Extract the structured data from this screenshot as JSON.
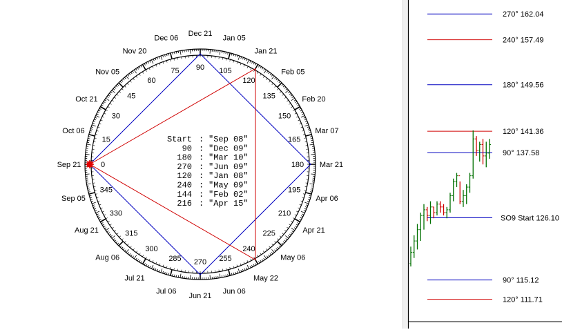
{
  "wheel": {
    "center_marker_color": "#e00000",
    "date_labels": [
      {
        "text": "Jun 21",
        "angle": 270
      },
      {
        "text": "Jun 06",
        "angle": 255
      },
      {
        "text": "Jul 06",
        "angle": 285
      },
      {
        "text": "May 22",
        "angle": 240
      },
      {
        "text": "Jul 21",
        "angle": 300
      },
      {
        "text": "May 06",
        "angle": 225
      },
      {
        "text": "Aug 06",
        "angle": 315
      },
      {
        "text": "Apr 21",
        "angle": 210
      },
      {
        "text": "Aug 21",
        "angle": 330
      },
      {
        "text": "Apr 06",
        "angle": 195
      },
      {
        "text": "Sep 05",
        "angle": 345
      },
      {
        "text": "Mar 21",
        "angle": 180
      },
      {
        "text": "Sep 21",
        "angle": 0
      },
      {
        "text": "Mar 07",
        "angle": 165
      },
      {
        "text": "Oct 06",
        "angle": 15
      },
      {
        "text": "Feb 20",
        "angle": 150
      },
      {
        "text": "Oct 21",
        "angle": 30
      },
      {
        "text": "Feb 05",
        "angle": 135
      },
      {
        "text": "Nov 05",
        "angle": 45
      },
      {
        "text": "Jan 21",
        "angle": 120
      },
      {
        "text": "Nov 20",
        "angle": 60
      },
      {
        "text": "Jan 05",
        "angle": 105
      },
      {
        "text": "Dec 06",
        "angle": 75
      },
      {
        "text": "Dec 21",
        "angle": 90
      }
    ],
    "degree_labels": [
      "0",
      "15",
      "30",
      "45",
      "60",
      "75",
      "90",
      "105",
      "120",
      "135",
      "150",
      "165",
      "180",
      "195",
      "210",
      "225",
      "240",
      "255",
      "270",
      "285",
      "300",
      "315",
      "330",
      "345"
    ],
    "legend": [
      {
        "label": "Start",
        "value": "\"Sep 08\""
      },
      {
        "label": "90",
        "value": "\"Dec 09\""
      },
      {
        "label": "180",
        "value": "\"Mar 10\""
      },
      {
        "label": "270",
        "value": "\"Jun 09\""
      },
      {
        "label": "120",
        "value": "\"Jan 08\""
      },
      {
        "label": "240",
        "value": "\"May 09\""
      },
      {
        "label": "144",
        "value": "\"Feb 02\""
      },
      {
        "label": "216",
        "value": "\"Apr 15\""
      }
    ],
    "square_color": "#0000c0",
    "triangle_color": "#d00000",
    "square_angles": [
      0,
      90,
      180,
      270
    ],
    "triangle_angles": [
      0,
      120,
      240
    ]
  },
  "chart_data": {
    "type": "line",
    "title": "",
    "levels": [
      {
        "label": "270° 162.04",
        "value": 162.04,
        "color": "#0000c0"
      },
      {
        "label": "240° 157.49",
        "value": 157.49,
        "color": "#d00000"
      },
      {
        "label": "180° 149.56",
        "value": 149.56,
        "color": "#0000c0"
      },
      {
        "label": "120° 141.36",
        "value": 141.36,
        "color": "#d00000"
      },
      {
        "label": "90° 137.58",
        "value": 137.58,
        "color": "#0000c0"
      },
      {
        "label": "SO9 Start 126.10",
        "value": 126.1,
        "color": "#0000c0"
      },
      {
        "label": "90° 115.12",
        "value": 115.12,
        "color": "#0000c0"
      },
      {
        "label": "120° 111.71",
        "value": 111.71,
        "color": "#d00000"
      }
    ],
    "price_range": [
      108.5,
      164.5
    ],
    "bars": [
      {
        "h": 121.0,
        "l": 117.5,
        "o": 118.0,
        "c": 120.0
      },
      {
        "h": 123.0,
        "l": 119.0,
        "o": 120.0,
        "c": 122.0
      },
      {
        "h": 125.0,
        "l": 120.5,
        "o": 122.0,
        "c": 124.0
      },
      {
        "h": 127.0,
        "l": 122.0,
        "o": 124.0,
        "c": 126.5
      },
      {
        "h": 128.5,
        "l": 124.0,
        "o": 126.5,
        "c": 127.5
      },
      {
        "h": 128.0,
        "l": 125.5,
        "o": 127.5,
        "c": 126.5
      },
      {
        "h": 129.0,
        "l": 125.0,
        "o": 126.5,
        "c": 128.0
      },
      {
        "h": 128.0,
        "l": 126.0,
        "o": 128.0,
        "c": 127.0
      },
      {
        "h": 129.0,
        "l": 126.5,
        "o": 127.0,
        "c": 128.5
      },
      {
        "h": 129.0,
        "l": 127.0,
        "o": 128.5,
        "c": 128.0
      },
      {
        "h": 128.5,
        "l": 126.5,
        "o": 128.0,
        "c": 127.0
      },
      {
        "h": 128.0,
        "l": 126.0,
        "o": 127.0,
        "c": 127.5
      },
      {
        "h": 130.5,
        "l": 127.0,
        "o": 127.5,
        "c": 130.0
      },
      {
        "h": 133.0,
        "l": 129.0,
        "o": 130.0,
        "c": 132.5
      },
      {
        "h": 134.0,
        "l": 131.5,
        "o": 132.5,
        "c": 133.5
      },
      {
        "h": 132.5,
        "l": 128.5,
        "o": 133.5,
        "c": 129.0
      },
      {
        "h": 131.0,
        "l": 128.0,
        "o": 129.0,
        "c": 130.0
      },
      {
        "h": 132.0,
        "l": 128.5,
        "o": 130.0,
        "c": 131.5
      },
      {
        "h": 134.0,
        "l": 130.5,
        "o": 131.5,
        "c": 133.5
      },
      {
        "h": 141.5,
        "l": 133.0,
        "o": 133.5,
        "c": 140.0
      },
      {
        "h": 140.5,
        "l": 137.0,
        "o": 140.0,
        "c": 138.0
      },
      {
        "h": 139.5,
        "l": 136.0,
        "o": 138.0,
        "c": 139.0
      },
      {
        "h": 140.0,
        "l": 135.5,
        "o": 139.0,
        "c": 137.0
      },
      {
        "h": 139.5,
        "l": 135.0,
        "o": 137.0,
        "c": 137.5
      },
      {
        "h": 140.0,
        "l": 136.5,
        "o": 137.5,
        "c": 139.0
      }
    ]
  }
}
